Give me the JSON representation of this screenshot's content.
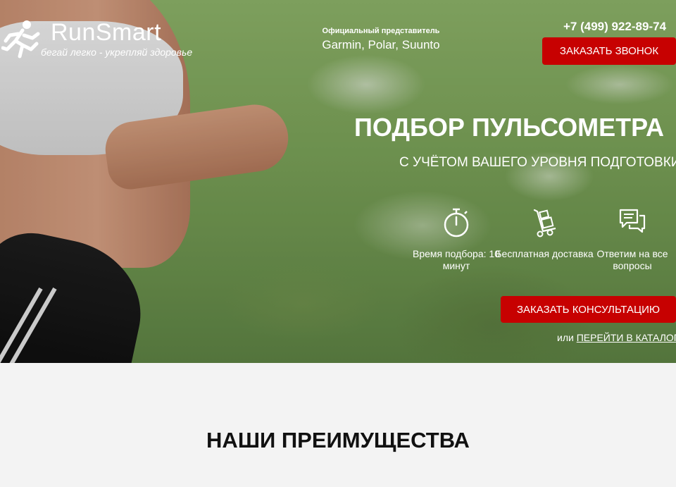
{
  "logo": {
    "name": "RunSmart",
    "slogan": "бегай легко - укрепляй здоровье"
  },
  "dealer": {
    "label": "Официальный представитель",
    "brands": "Garmin, Polar, Suunto"
  },
  "header": {
    "phone": "+7 (499) 922-89-74",
    "call_button": "ЗАКАЗАТЬ ЗВОНОК"
  },
  "hero": {
    "title": "ПОДБОР ПУЛЬСОМЕТРА",
    "subtitle": "С УЧЁТОМ ВАШЕГО УРОВНЯ ПОДГОТОВКИ",
    "features": [
      {
        "icon": "stopwatch-icon",
        "text": "Время подбора: 10 минут"
      },
      {
        "icon": "delivery-cart-icon",
        "text": "Бесплатная доставка"
      },
      {
        "icon": "chat-bubbles-icon",
        "text": "Ответим на все вопросы"
      }
    ],
    "consult_button": "ЗАКАЗАТЬ КОНСУЛЬТАЦИЮ",
    "catalog_prefix": "или",
    "catalog_link": "ПЕРЕЙТИ В КАТАЛОГ"
  },
  "advantages": {
    "title": "НАШИ ПРЕИМУЩЕСТВА"
  },
  "colors": {
    "accent": "#c70101",
    "section_bg": "#f3f3f3"
  }
}
